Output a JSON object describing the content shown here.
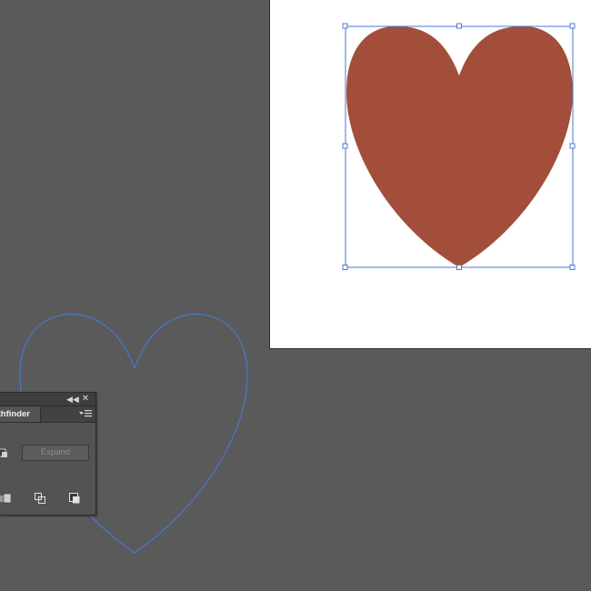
{
  "app": {
    "canvas": {
      "background": "#5a5a5a",
      "artboard_color": "#ffffff"
    },
    "artwork": {
      "selected_heart": {
        "fill": "#a34e3a",
        "selected": true,
        "selection_color": "#4a78d6"
      },
      "outline_heart": {
        "stroke": "#4a78d6",
        "fill": "none"
      }
    },
    "pathfinder_panel": {
      "tab_label": "Pathfinder",
      "expand_button_label": "Expand",
      "expand_enabled": false,
      "collapse_icon": "double-chevron-left-icon",
      "close_icon": "close-icon",
      "menu_icon": "panel-menu-icon"
    }
  }
}
